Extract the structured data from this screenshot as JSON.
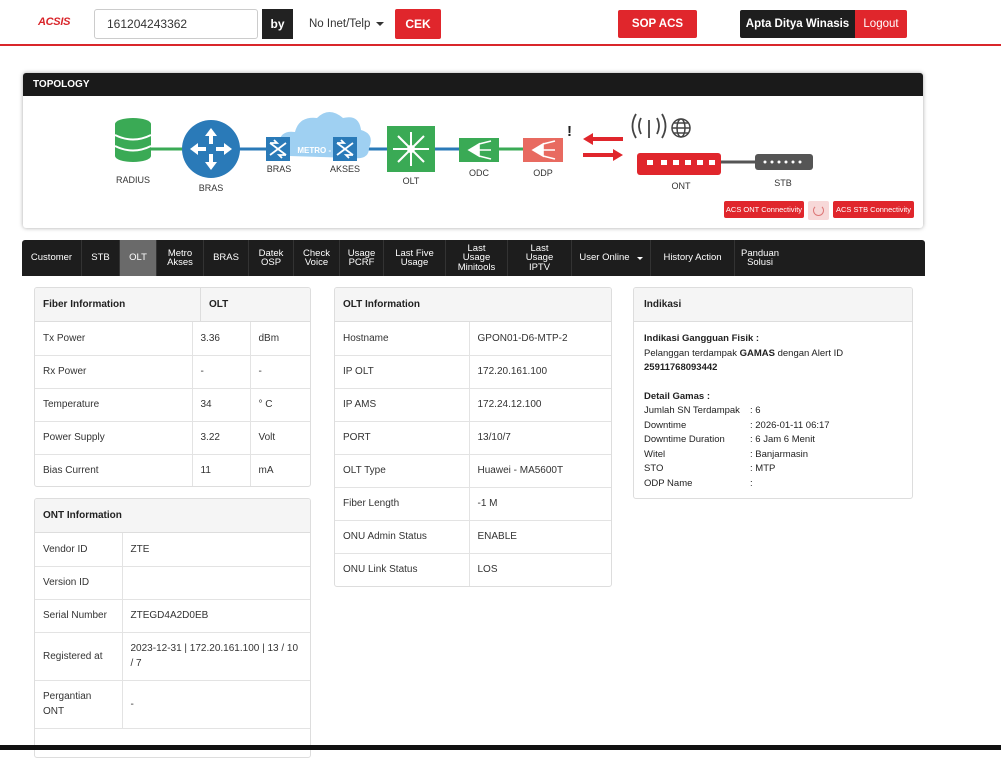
{
  "header": {
    "logo": "ACSIS",
    "search_value": "161204243362",
    "by_label": "by",
    "by_select": "No Inet/Telp",
    "cek_label": "CEK",
    "sop_label": "SOP ACS",
    "user_name": "Apta Ditya Winasis",
    "logout_label": "Logout"
  },
  "topology": {
    "title": "TOPOLOGY",
    "nodes": {
      "radius": "RADIUS",
      "bras": "BRAS",
      "bras2": "BRAS",
      "metro": "METRO - E",
      "akses": "AKSES",
      "olt": "OLT",
      "odc": "ODC",
      "odp": "ODP",
      "ont": "ONT",
      "stb": "STB",
      "alert": "!"
    },
    "acs_ont_label": "ACS ONT Connectivity",
    "acs_stb_label": "ACS STB Connectivity"
  },
  "tabs": [
    {
      "label": "Customer"
    },
    {
      "label": "STB"
    },
    {
      "label": "OLT"
    },
    {
      "label": "Metro Akses"
    },
    {
      "label": "BRAS"
    },
    {
      "label": "Datek OSP"
    },
    {
      "label": "Check Voice"
    },
    {
      "label": "Usage PCRF"
    },
    {
      "label": "Last Five Usage"
    },
    {
      "label": "Last Usage Minitools"
    },
    {
      "label": "Last Usage IPTV"
    },
    {
      "label": "User Online"
    },
    {
      "label": "History Action"
    },
    {
      "label": "Panduan Solusi"
    }
  ],
  "fiber": {
    "title": "Fiber Information",
    "title2": "OLT",
    "rows": [
      {
        "label": "Tx Power",
        "value": "3.36",
        "unit": "dBm"
      },
      {
        "label": "Rx Power",
        "value": "-",
        "unit": "-"
      },
      {
        "label": "Temperature",
        "value": "34",
        "unit": "° C"
      },
      {
        "label": "Power Supply",
        "value": "3.22",
        "unit": "Volt"
      },
      {
        "label": "Bias Current",
        "value": "11",
        "unit": "mA"
      }
    ]
  },
  "ont": {
    "title": "ONT Information",
    "rows": [
      {
        "label": "Vendor ID",
        "value": "ZTE"
      },
      {
        "label": "Version ID",
        "value": ""
      },
      {
        "label": "Serial Number",
        "value": "ZTEGD4A2D0EB"
      },
      {
        "label": "Registered at",
        "value": "2023-12-31 | 172.20.161.100 | 13 / 10 / 7"
      },
      {
        "label": "Pergantian ONT",
        "value": "-"
      }
    ]
  },
  "olt": {
    "title": "OLT Information",
    "rows": [
      {
        "label": "Hostname",
        "value": "GPON01-D6-MTP-2"
      },
      {
        "label": "IP OLT",
        "value": "172.20.161.100"
      },
      {
        "label": "IP AMS",
        "value": "172.24.12.100"
      },
      {
        "label": "PORT",
        "value": "13/10/7"
      },
      {
        "label": "OLT Type",
        "value": "Huawei - MA5600T"
      },
      {
        "label": "Fiber Length",
        "value": "-1 M"
      },
      {
        "label": "ONU Admin Status",
        "value": "ENABLE"
      },
      {
        "label": "ONU Link Status",
        "value": "LOS"
      }
    ]
  },
  "indikasi": {
    "title": "Indikasi",
    "gangguan_title": "Indikasi Gangguan Fisik :",
    "gangguan_prefix": "Pelanggan terdampak ",
    "gangguan_gamas": "GAMAS",
    "gangguan_suffix": " dengan Alert ID",
    "alert_id": "25911768093442",
    "detail_title": "Detail Gamas :",
    "details": [
      {
        "label": "Jumlah SN Terdampak",
        "value": ": 6"
      },
      {
        "label": "Downtime",
        "value": ": 2026-01-11 06:17"
      },
      {
        "label": "Downtime Duration",
        "value": ": 6 Jam 6 Menit"
      },
      {
        "label": "Witel",
        "value": ": Banjarmasin"
      },
      {
        "label": "STO",
        "value": ": MTP"
      },
      {
        "label": "ODP Name",
        "value": ":"
      }
    ]
  }
}
